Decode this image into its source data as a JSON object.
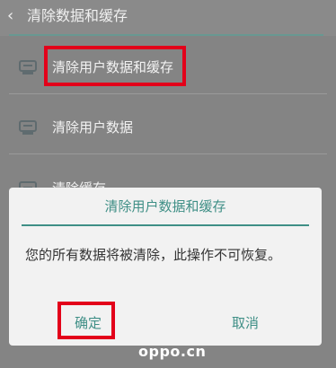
{
  "header": {
    "title": "清除数据和缓存"
  },
  "list": [
    {
      "label": "清除用户数据和缓存",
      "icon": "phone-clean-icon"
    },
    {
      "label": "清除用户数据",
      "icon": "phone-user-data-icon"
    },
    {
      "label": "清除缓存",
      "icon": "cache-icon"
    }
  ],
  "dialog": {
    "title": "清除用户数据和缓存",
    "message": "您的所有数据将被清除，此操作不可恢复。",
    "confirm": "确定",
    "cancel": "取消"
  },
  "watermark": "oppo.cn",
  "colors": {
    "accent": "#3f8f86",
    "highlight": "#e3001a",
    "overlay": "#848484"
  }
}
